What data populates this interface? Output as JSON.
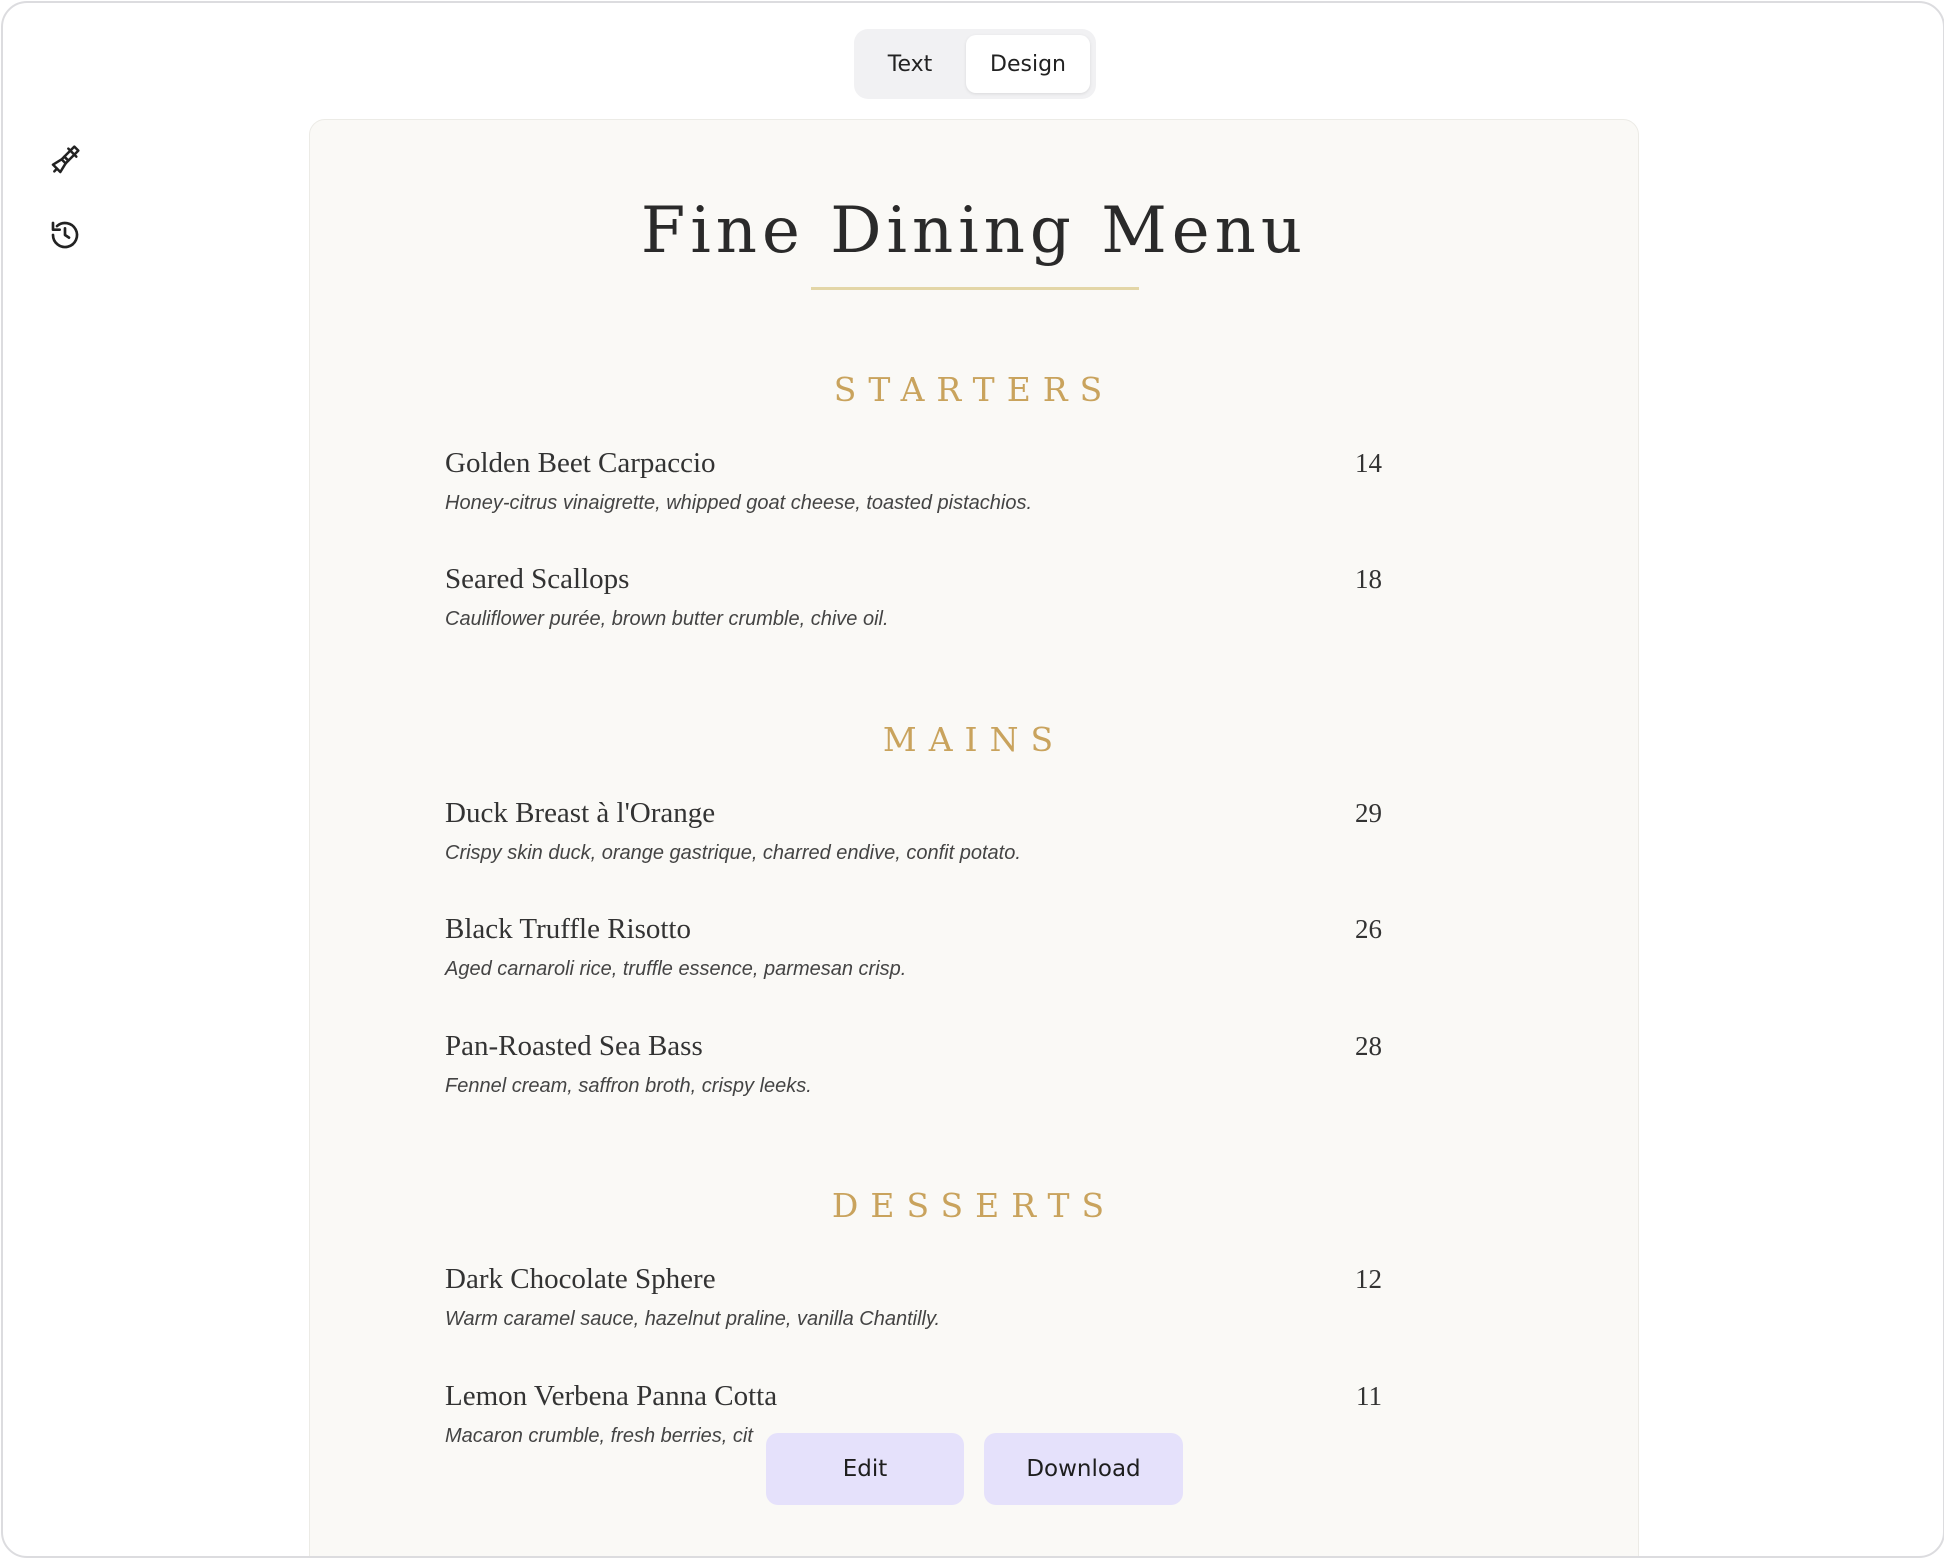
{
  "view_toggle": {
    "options": [
      {
        "label": "Text",
        "active": false
      },
      {
        "label": "Design",
        "active": true
      }
    ]
  },
  "side_tools": [
    {
      "icon": "paintbrush-icon"
    },
    {
      "icon": "history-icon"
    }
  ],
  "menu": {
    "title": "Fine Dining Menu",
    "accent_color": "#c9a35d",
    "sections": [
      {
        "heading": "STARTERS",
        "items": [
          {
            "name": "Golden Beet Carpaccio",
            "price": "14",
            "description": "Honey-citrus vinaigrette, whipped goat cheese, toasted pistachios."
          },
          {
            "name": "Seared Scallops",
            "price": "18",
            "description": "Cauliflower purée, brown butter crumble, chive oil."
          }
        ]
      },
      {
        "heading": "MAINS",
        "items": [
          {
            "name": "Duck Breast à l'Orange",
            "price": "29",
            "description": "Crispy skin duck, orange gastrique, charred endive, confit potato."
          },
          {
            "name": "Black Truffle Risotto",
            "price": "26",
            "description": "Aged carnaroli rice, truffle essence, parmesan crisp."
          },
          {
            "name": "Pan-Roasted Sea Bass",
            "price": "28",
            "description": "Fennel cream, saffron broth, crispy leeks."
          }
        ]
      },
      {
        "heading": "DESSERTS",
        "items": [
          {
            "name": "Dark Chocolate Sphere",
            "price": "12",
            "description": "Warm caramel sauce, hazelnut praline, vanilla Chantilly."
          },
          {
            "name": "Lemon Verbena Panna Cotta",
            "price": "11",
            "description": "Macaron crumble, fresh berries, cit"
          }
        ]
      }
    ]
  },
  "actions": {
    "edit_label": "Edit",
    "download_label": "Download",
    "button_color": "#e5e1fb"
  }
}
